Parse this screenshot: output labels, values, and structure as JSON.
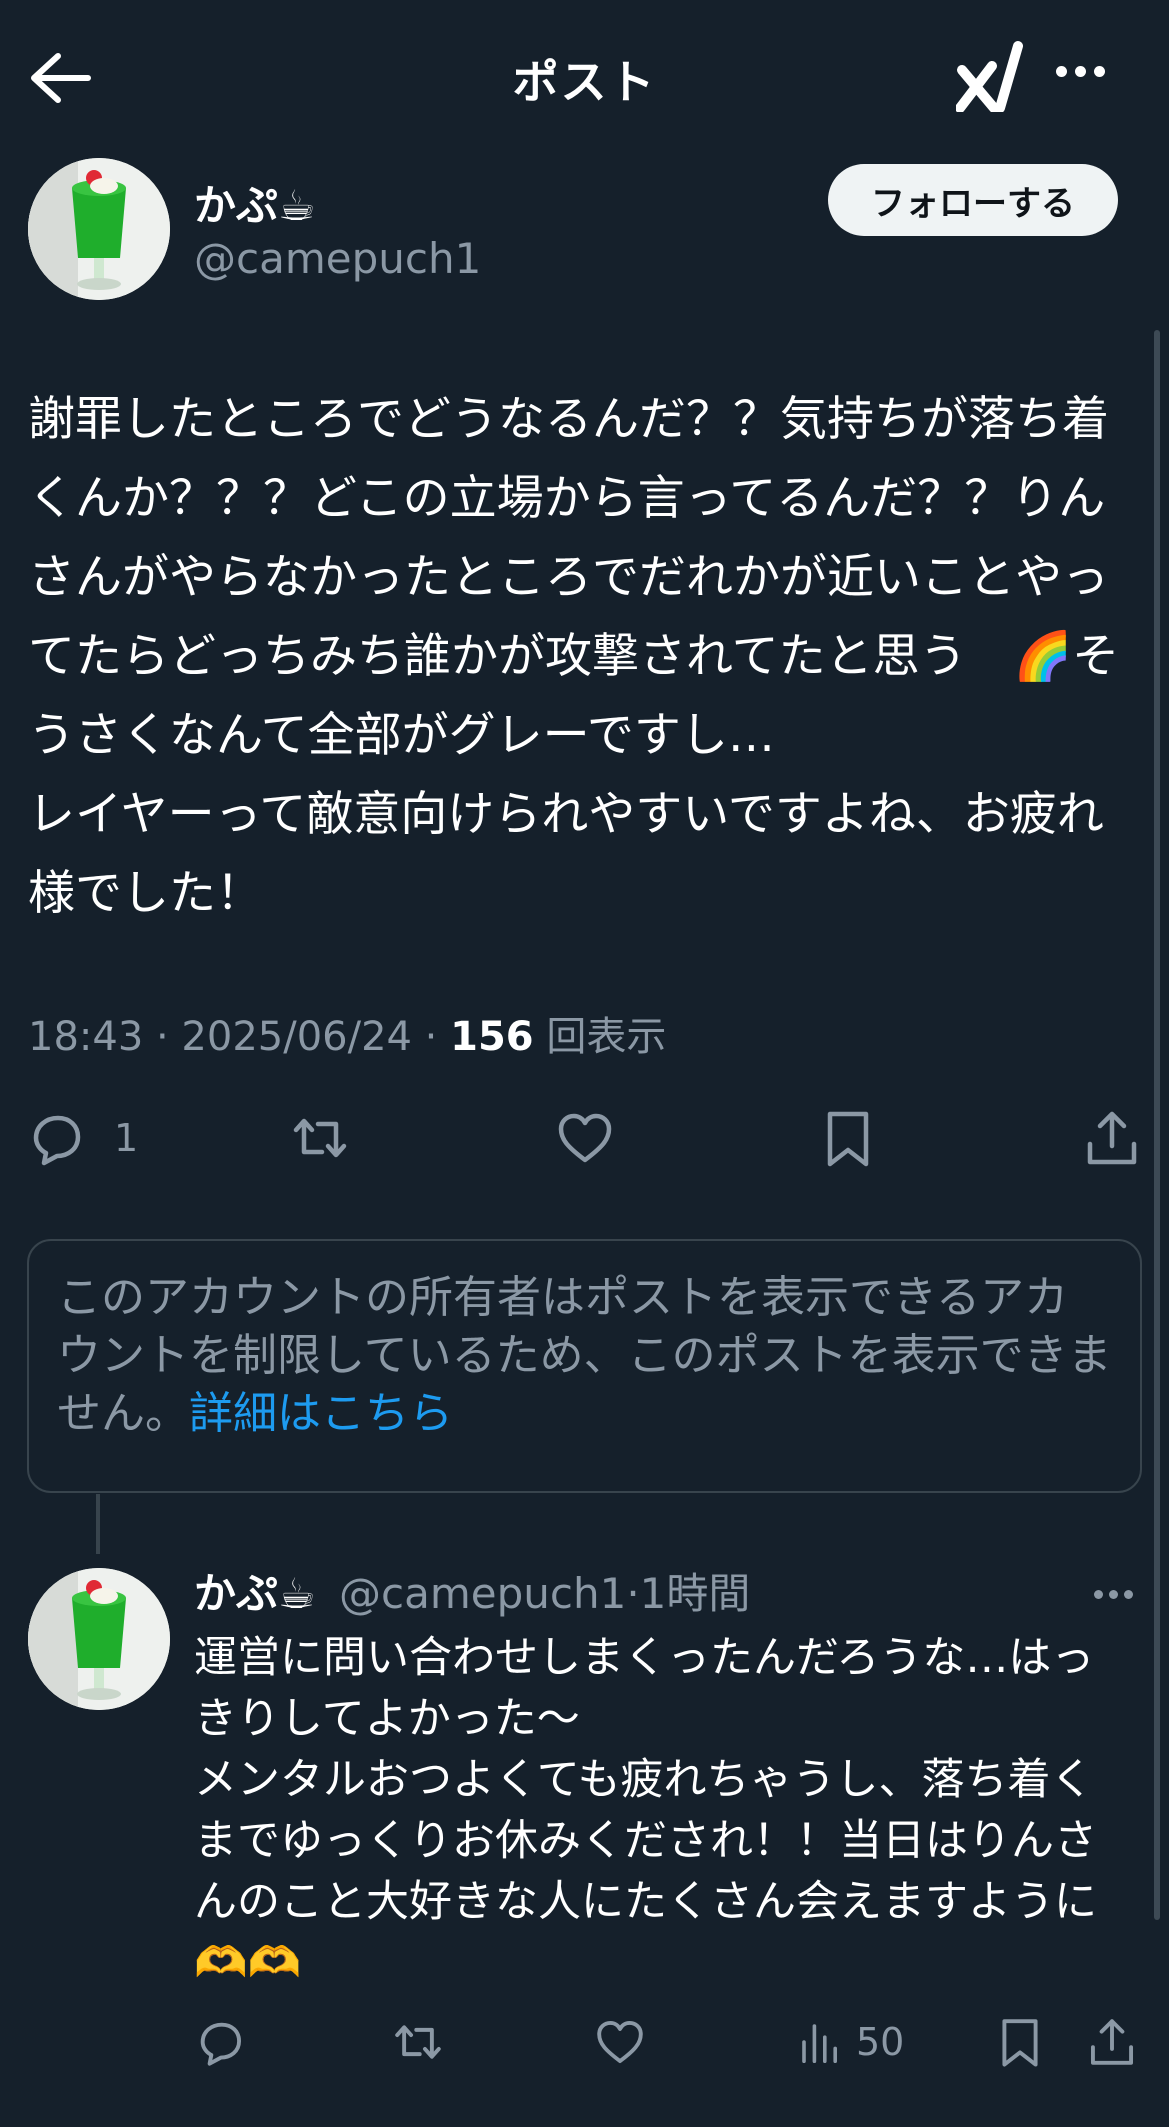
{
  "header": {
    "title": "ポスト",
    "back_icon": "arrow-left-icon",
    "logo_icon": "grok-logo-icon",
    "more_icon": "more-horizontal-icon"
  },
  "post": {
    "author_name": "かぷ☕",
    "author_handle": "@camepuch1",
    "follow_label": "フォローする",
    "body": "謝罪したところでどうなるんだ？？気持ちが落ち着くんか？？？どこの立場から言ってるんだ？？りんさんがやらなかったところでだれかが近いことやってたらどっちみち誰かが攻撃されてたと思う　🌈そうさくなんて全部がグレーですし…\nレイヤーって敵意向けられやすいですよね、お疲れ様でした！",
    "time": "18:43 · 2025/06/24 · ",
    "views_count": "156",
    "views_label": " 回表示",
    "reply_count": "1"
  },
  "notice": {
    "text": "このアカウントの所有者はポストを表示できるアカウントを制限しているため、このポストを表示できません。",
    "link": "詳細はこちら"
  },
  "reply": {
    "author_name": "かぷ☕",
    "author_handle": "@camepuch1",
    "time": "·1時間",
    "body": "運営に問い合わせしまくったんだろうな…はっきりしてよかった〜\nメンタルおつよくても疲れちゃうし、落ち着くまでゆっくりお休みくだされ！！当日はりんさんのこと大好きな人にたくさん会えますように🫶🫶",
    "views": "50"
  },
  "colors": {
    "background": "#15202b",
    "text": "#ffffff",
    "muted": "#8b98a5",
    "link": "#1d9bf0",
    "border": "#38444d"
  }
}
